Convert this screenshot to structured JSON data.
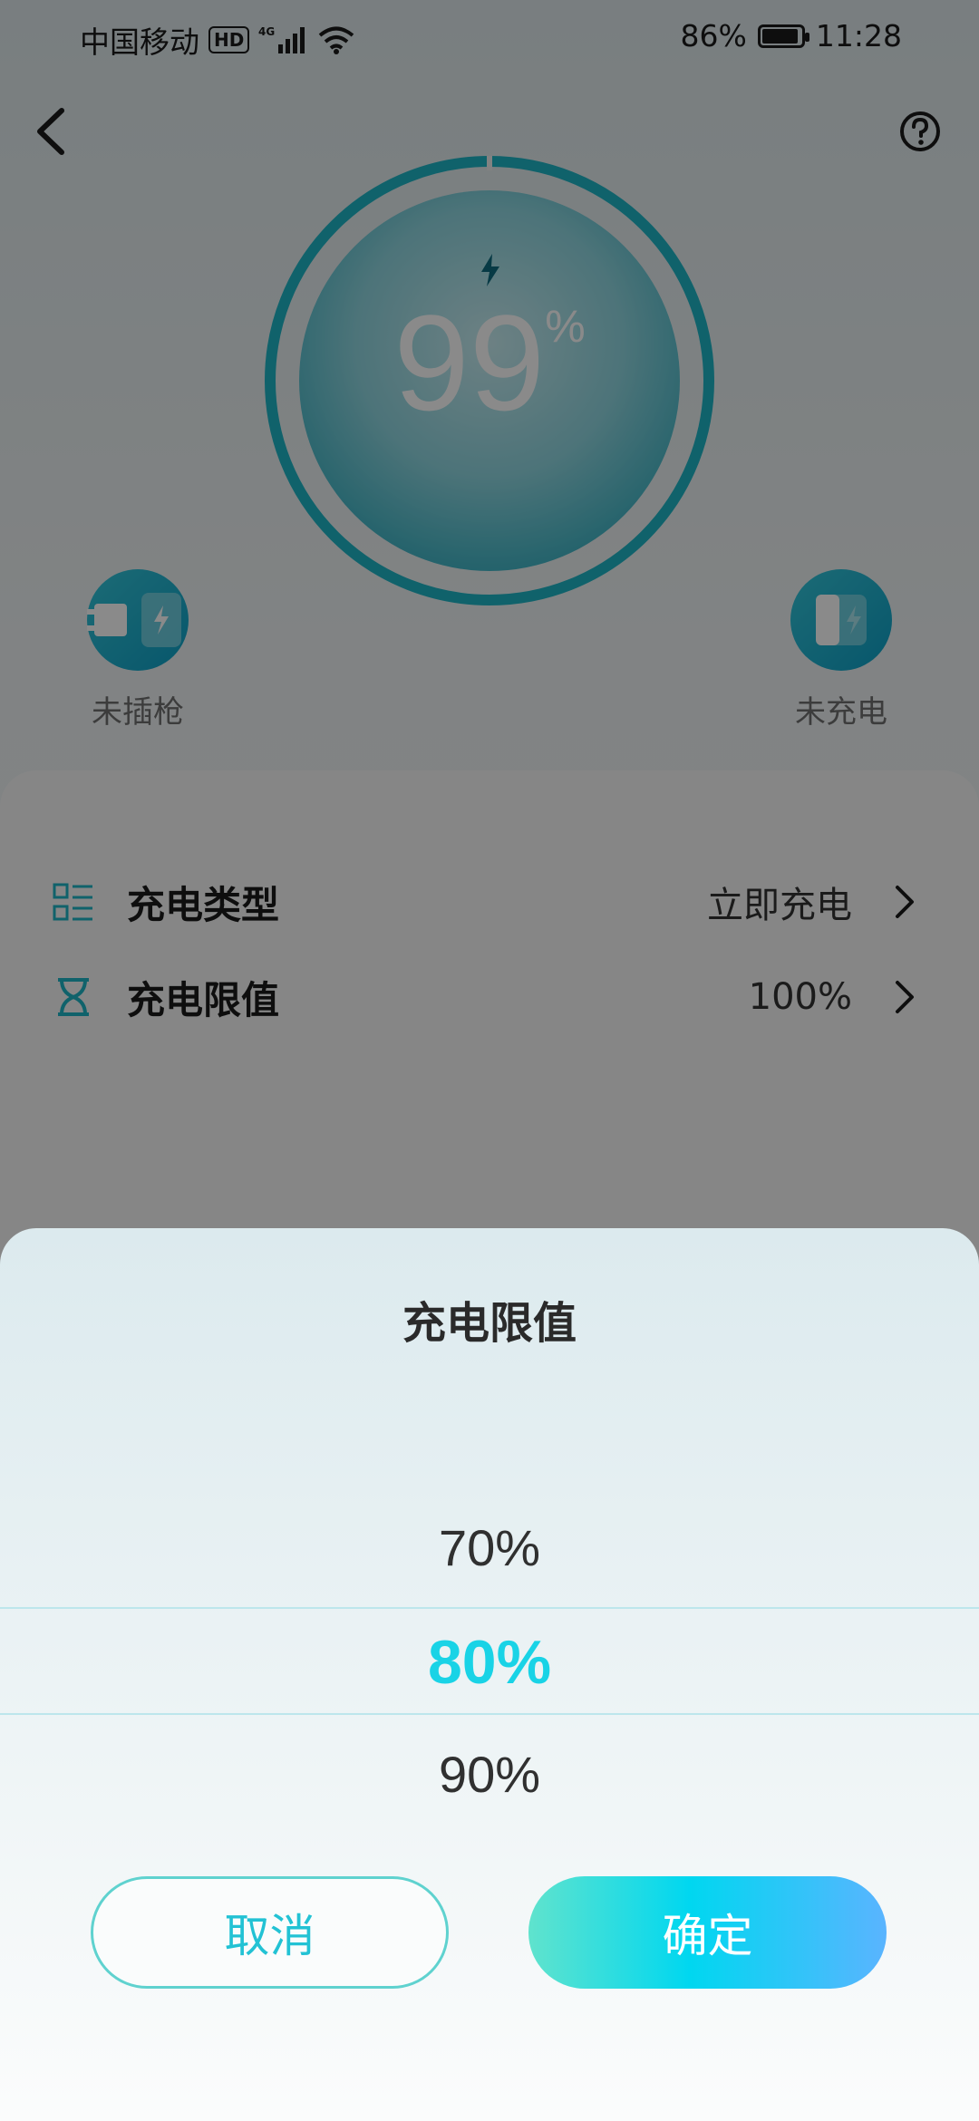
{
  "status_bar": {
    "carrier": "中国移动",
    "hd": "HD",
    "network": "4G",
    "battery": "86%",
    "time": "11:28"
  },
  "gauge": {
    "percent": "99",
    "unit": "%"
  },
  "indicators": {
    "plug_label": "未插枪",
    "charge_label": "未充电"
  },
  "settings": {
    "items": [
      {
        "label": "充电类型",
        "value": "立即充电"
      },
      {
        "label": "充电限值",
        "value": "100%"
      }
    ]
  },
  "sheet": {
    "title": "充电限值",
    "options": [
      "70%",
      "80%",
      "90%"
    ],
    "selected_index": 1,
    "cancel": "取消",
    "confirm": "确定"
  },
  "colors": {
    "accent": "#19d3e6",
    "gauge_ring": "#1fb5c6"
  }
}
